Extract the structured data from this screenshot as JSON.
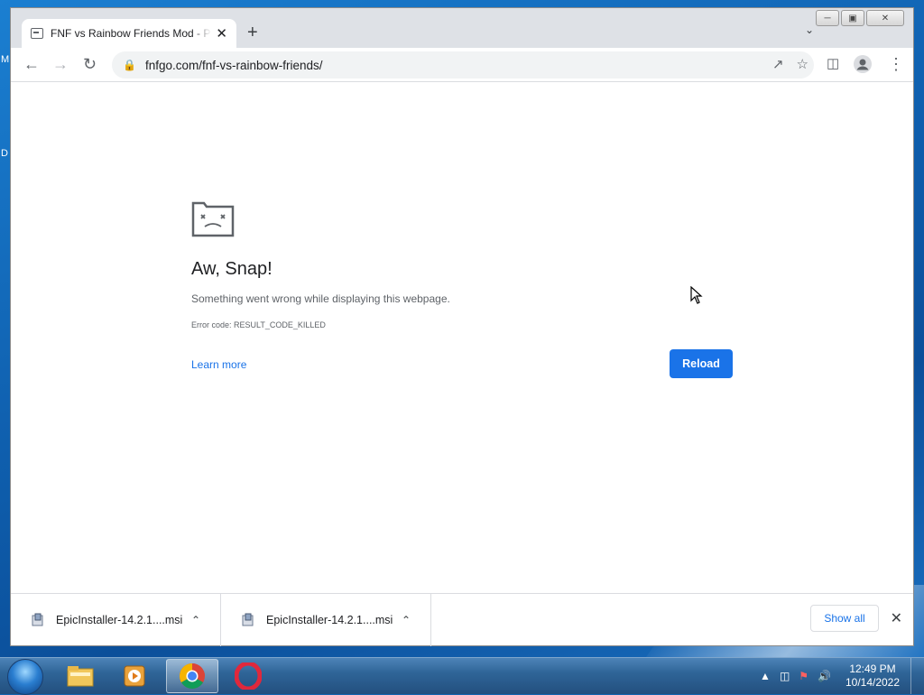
{
  "desktop": {
    "edge_letters": [
      "M",
      "D"
    ]
  },
  "browser": {
    "tab": {
      "title": "FNF vs Rainbow Friends Mod - Play Online"
    },
    "toolbar": {
      "url": "fnfgo.com/fnf-vs-rainbow-friends/"
    }
  },
  "error_page": {
    "title": "Aw, Snap!",
    "message": "Something went wrong while displaying this webpage.",
    "error_code": "Error code: RESULT_CODE_KILLED",
    "learn_more": "Learn more",
    "reload": "Reload"
  },
  "downloads": {
    "items": [
      {
        "name": "EpicInstaller-14.2.1....msi"
      },
      {
        "name": "EpicInstaller-14.2.1....msi"
      }
    ],
    "show_all": "Show all"
  },
  "taskbar": {
    "time": "12:49 PM",
    "date": "10/14/2022"
  }
}
